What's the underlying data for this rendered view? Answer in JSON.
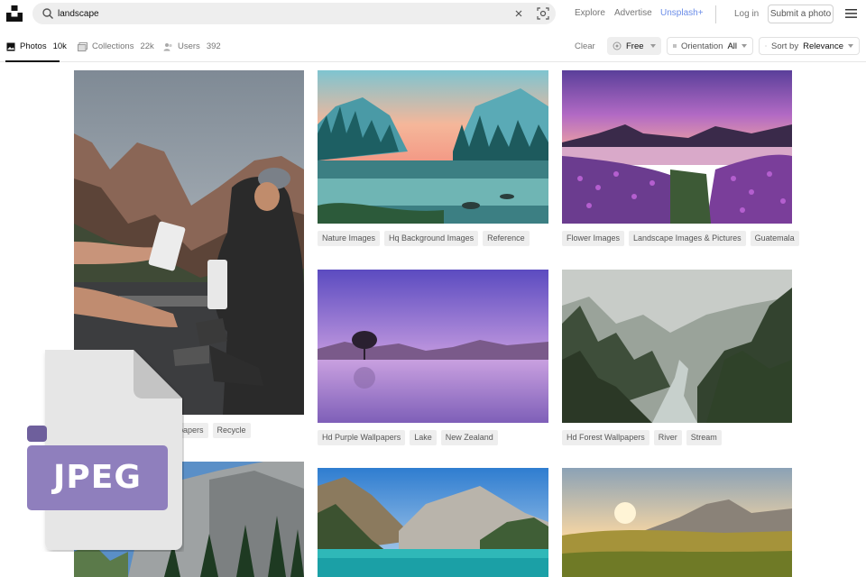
{
  "header": {
    "search_value": "landscape",
    "nav": [
      "Explore",
      "Advertise",
      "Unsplash+"
    ],
    "login_label": "Log in",
    "submit_label": "Submit a photo"
  },
  "tabs": [
    {
      "label": "Photos",
      "count": "10k"
    },
    {
      "label": "Collections",
      "count": "22k"
    },
    {
      "label": "Users",
      "count": "392"
    }
  ],
  "filters": {
    "clear_label": "Clear",
    "license_value": "Free",
    "orientation_label": "Orientation",
    "orientation_value": "All",
    "sort_label": "Sort by",
    "sort_value": "Relevance"
  },
  "photos": {
    "col1_top": {
      "tags": [
        "papers",
        "Recycle"
      ]
    },
    "col2_top": {
      "tags": [
        "Nature Images",
        "Hq Background Images",
        "Reference"
      ]
    },
    "col3_top": {
      "tags": [
        "Flower Images",
        "Landscape Images & Pictures",
        "Guatemala"
      ]
    },
    "col2_mid": {
      "tags": [
        "Hd Purple Wallpapers",
        "Lake",
        "New Zealand"
      ]
    },
    "col3_mid": {
      "tags": [
        "Hd Forest Wallpapers",
        "River",
        "Stream"
      ]
    }
  },
  "overlay": {
    "file_type": "JPEG",
    "badge_color": "#8f7fbd"
  }
}
